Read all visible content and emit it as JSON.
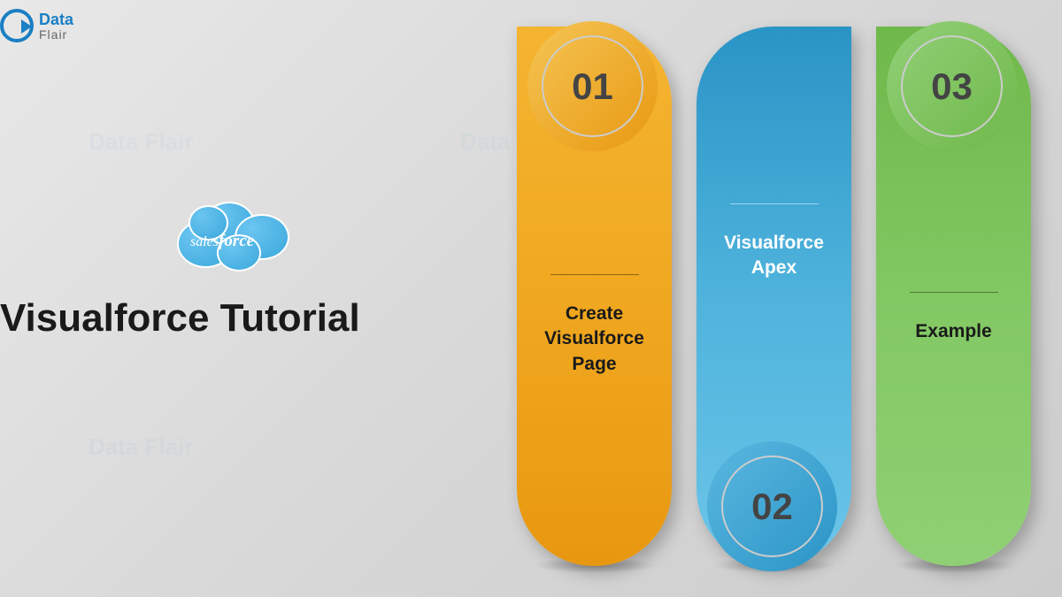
{
  "logo": {
    "text1": "Data",
    "text2": "Flair"
  },
  "cloud": {
    "sales": "sales",
    "force": "force"
  },
  "title": "Visualforce Tutorial",
  "panels": [
    {
      "number": "01",
      "label": "Create\nVisualforce\nPage"
    },
    {
      "number": "02",
      "label": "Visualforce\nApex"
    },
    {
      "number": "03",
      "label": "Example"
    }
  ]
}
